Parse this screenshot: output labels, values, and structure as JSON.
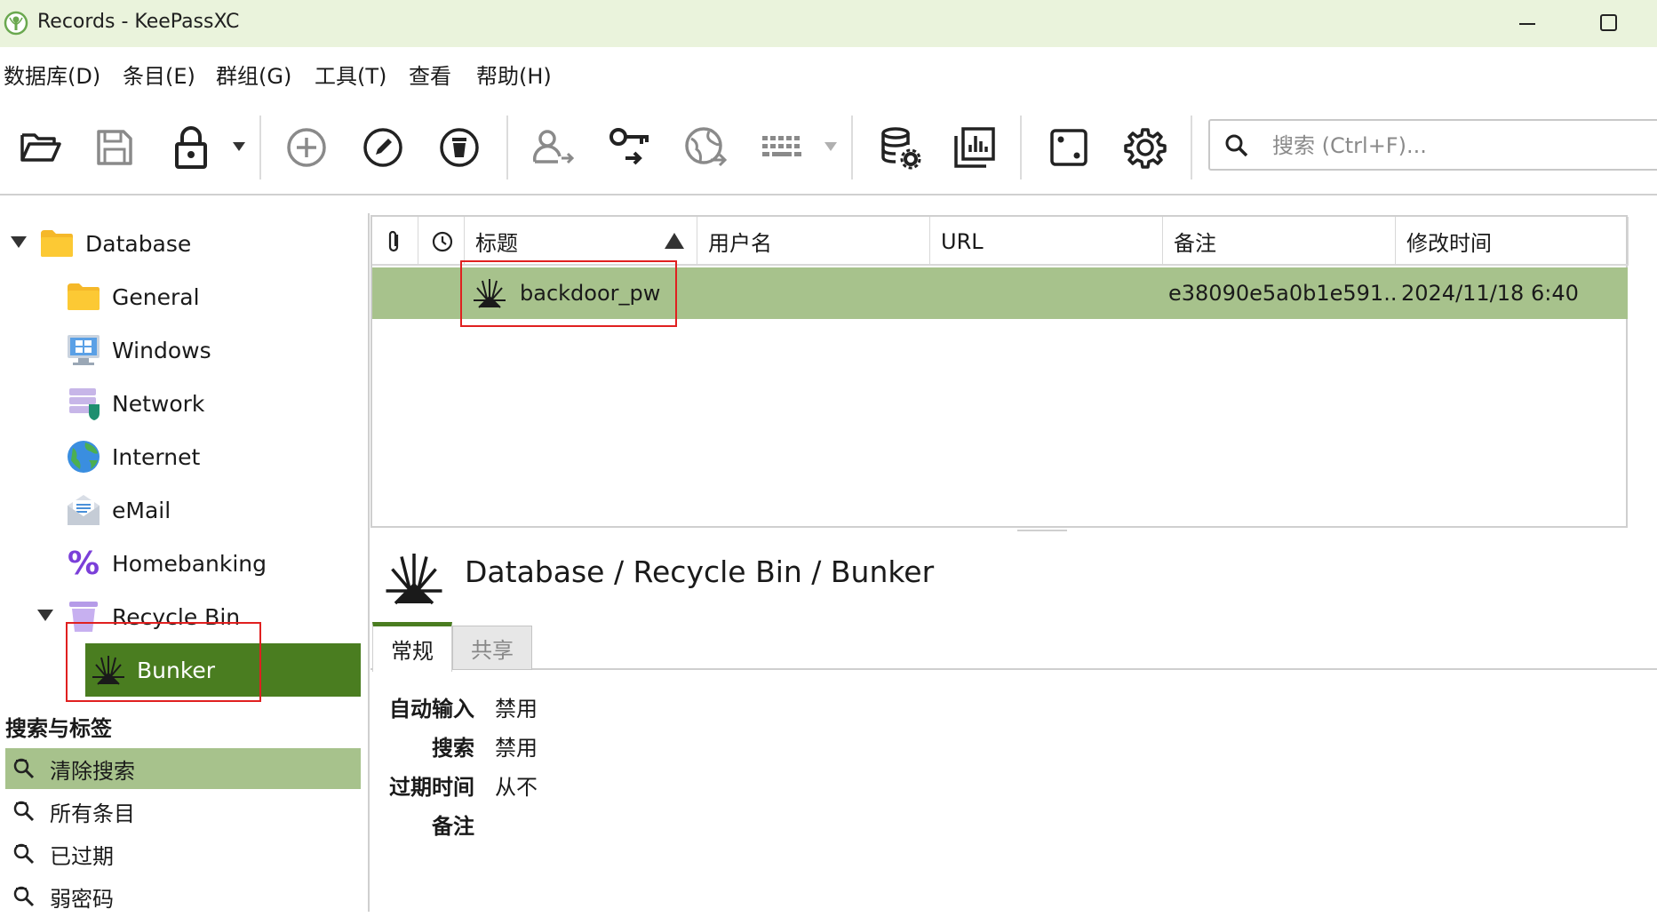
{
  "window": {
    "title": "Records - KeePassXC"
  },
  "menu": [
    "数据库(D)",
    "条目(E)",
    "群组(G)",
    "工具(T)",
    "查看",
    "帮助(H)"
  ],
  "toolbar": {
    "buttons": [
      "open-database-icon",
      "save-database-icon",
      "lock-database-icon",
      "add-entry-icon",
      "edit-entry-icon",
      "delete-entry-icon",
      "copy-username-icon",
      "copy-password-icon",
      "open-url-icon",
      "autotype-keyboard-icon",
      "database-settings-icon",
      "reports-icon",
      "password-generator-icon",
      "settings-icon"
    ],
    "search_placeholder": "搜索 (Ctrl+F)..."
  },
  "tree": {
    "root": "Database",
    "groups": [
      "General",
      "Windows",
      "Network",
      "Internet",
      "eMail",
      "Homebanking"
    ],
    "recycle_bin": "Recycle Bin",
    "recycle_child": "Bunker"
  },
  "tags": {
    "title": "搜索与标签",
    "items": [
      "清除搜索",
      "所有条目",
      "已过期",
      "弱密码"
    ]
  },
  "table": {
    "columns": [
      "标题",
      "用户名",
      "URL",
      "备注",
      "修改时间"
    ],
    "rows": [
      {
        "title": "backdoor_pw",
        "username": "",
        "url": "",
        "notes": "e38090e5a0b1e591...",
        "modified": "2024/11/18 6:40"
      }
    ]
  },
  "detail": {
    "path": "Database / Recycle Bin / Bunker",
    "tabs": [
      "常规",
      "共享"
    ],
    "fields": [
      {
        "label": "自动输入",
        "value": "禁用"
      },
      {
        "label": "搜索",
        "value": "禁用"
      },
      {
        "label": "过期时间",
        "value": "从不"
      },
      {
        "label": "备注",
        "value": ""
      }
    ]
  },
  "colors": {
    "titlebar": "#eaf3dc",
    "selected_group": "#4a7d20",
    "selected_row": "#a7c28c",
    "highlight_box": "#e02020"
  }
}
